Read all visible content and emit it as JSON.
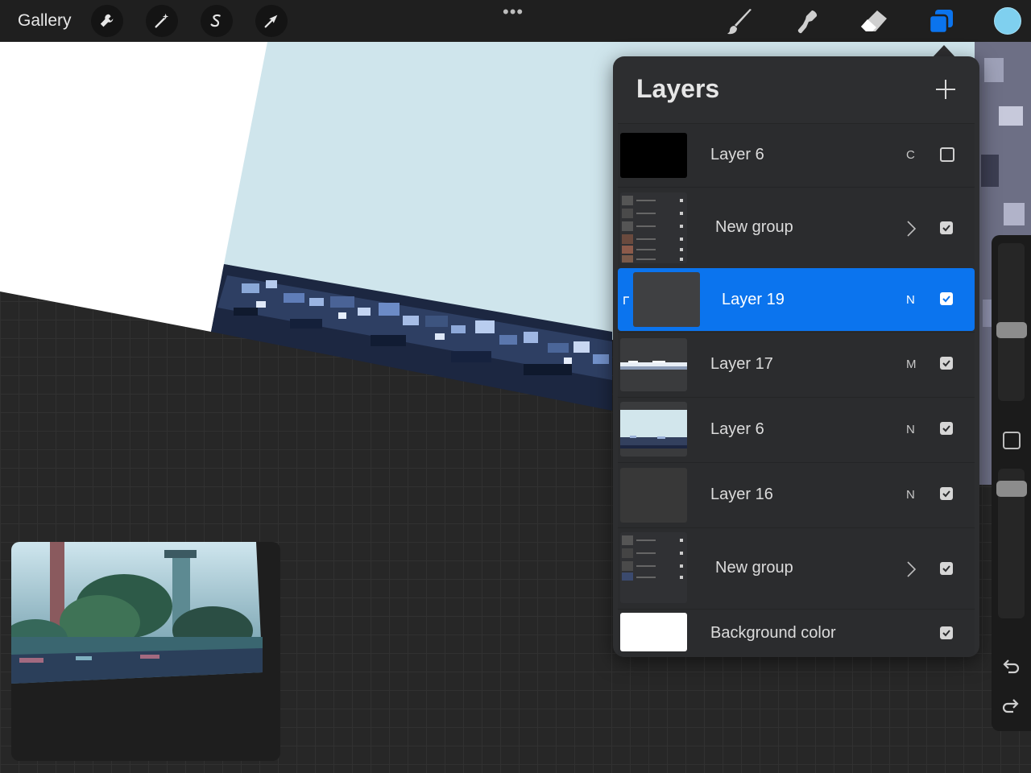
{
  "topbar": {
    "gallery_label": "Gallery",
    "more_label": "•••",
    "tools_left": [
      "wrench-icon",
      "magic-wand-icon",
      "selection-icon",
      "transform-arrow-icon"
    ],
    "tools_right": [
      "brush-icon",
      "smudge-icon",
      "eraser-icon",
      "layers-icon"
    ],
    "current_color": "#7fd0ef",
    "accent_color": "#0b74ee"
  },
  "layers_panel": {
    "title": "Layers",
    "add_icon": "plus-icon",
    "layers": [
      {
        "name": "Layer 6",
        "blend": "C",
        "visible": false,
        "type": "layer"
      },
      {
        "name": "New group",
        "blend": "",
        "visible": true,
        "type": "group"
      },
      {
        "name": "Layer 19",
        "blend": "N",
        "visible": true,
        "type": "layer",
        "selected": true,
        "clipped": true
      },
      {
        "name": "Layer 17",
        "blend": "M",
        "visible": true,
        "type": "layer"
      },
      {
        "name": "Layer 6",
        "blend": "N",
        "visible": true,
        "type": "layer"
      },
      {
        "name": "Layer 16",
        "blend": "N",
        "visible": true,
        "type": "layer"
      },
      {
        "name": "New group",
        "blend": "",
        "visible": true,
        "type": "group"
      },
      {
        "name": "Background color",
        "blend": "",
        "visible": true,
        "type": "background"
      }
    ]
  },
  "sidebar": {
    "icons": [
      "brush-size-slider",
      "modify-button",
      "opacity-slider",
      "undo-icon",
      "redo-icon"
    ]
  }
}
